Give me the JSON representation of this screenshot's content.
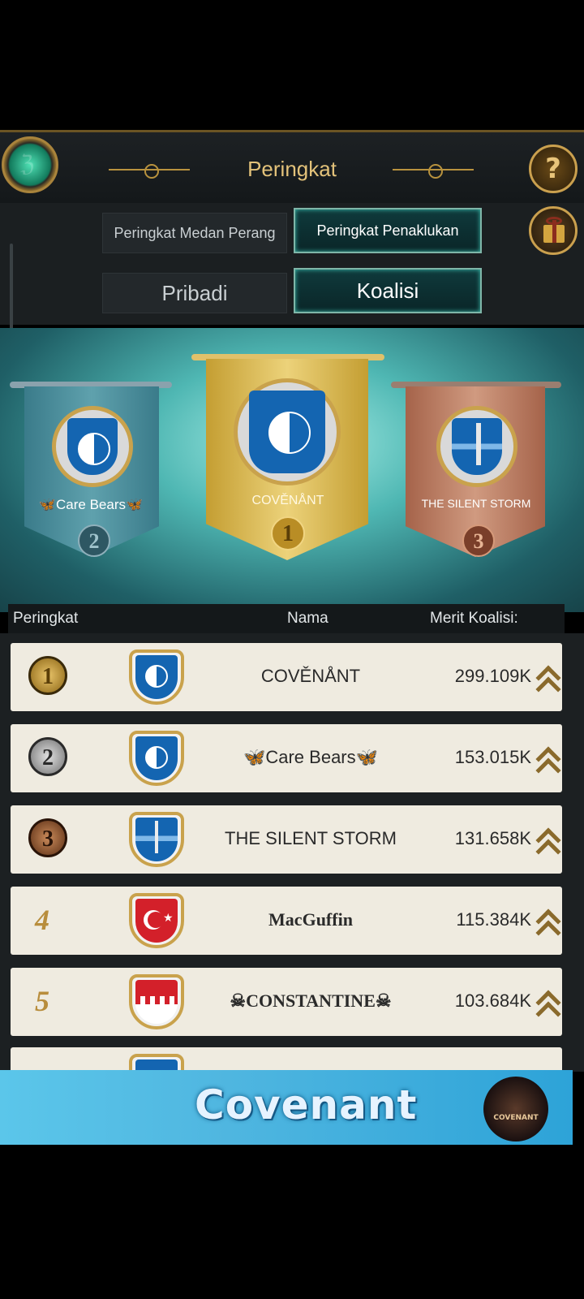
{
  "header": {
    "title": "Peringkat",
    "back_icon": "emerald-gem-back-icon",
    "help_label": "?",
    "gift_icon": "gift-icon"
  },
  "tabs": {
    "category": [
      {
        "label": "Peringkat Medan Perang",
        "active": false
      },
      {
        "label": "Peringkat Penaklukan",
        "active": true
      }
    ],
    "scope": [
      {
        "label": "Pribadi",
        "active": false
      },
      {
        "label": "Koalisi",
        "active": true
      }
    ]
  },
  "podium": [
    {
      "rank": "2",
      "name": "🦋Care Bears🦋",
      "emblem": "yin-yang-icon"
    },
    {
      "rank": "1",
      "name": "COVĚNÅNT",
      "emblem": "yin-yang-icon"
    },
    {
      "rank": "3",
      "name": "THE SILENT STORM",
      "emblem": "sword-icon"
    }
  ],
  "table": {
    "headers": {
      "rank": "Peringkat",
      "name": "Nama",
      "merit": "Merit Koalisi:"
    },
    "rows": [
      {
        "rank": "1",
        "name": "COVĚNÅNT",
        "merit": "299.109K",
        "emblem": "yin-yang-icon"
      },
      {
        "rank": "2",
        "name": "🦋Care Bears🦋",
        "merit": "153.015K",
        "emblem": "yin-yang-icon"
      },
      {
        "rank": "3",
        "name": "THE SILENT STORM",
        "merit": "131.658K",
        "emblem": "sword-icon"
      },
      {
        "rank": "4",
        "name": "MacGuffin",
        "merit": "115.384K",
        "emblem": "turkey-flag-icon"
      },
      {
        "rank": "5",
        "name": "☠CONSTANTINE☠",
        "merit": "103.684K",
        "emblem": "bahrain-flag-icon"
      }
    ]
  },
  "promo": {
    "text": "Covenant",
    "logo_text": "COVENANT"
  },
  "colors": {
    "gold": "#e3c27a",
    "active_tab_border": "#7fb6a8",
    "row_bg": "#efebe0"
  }
}
